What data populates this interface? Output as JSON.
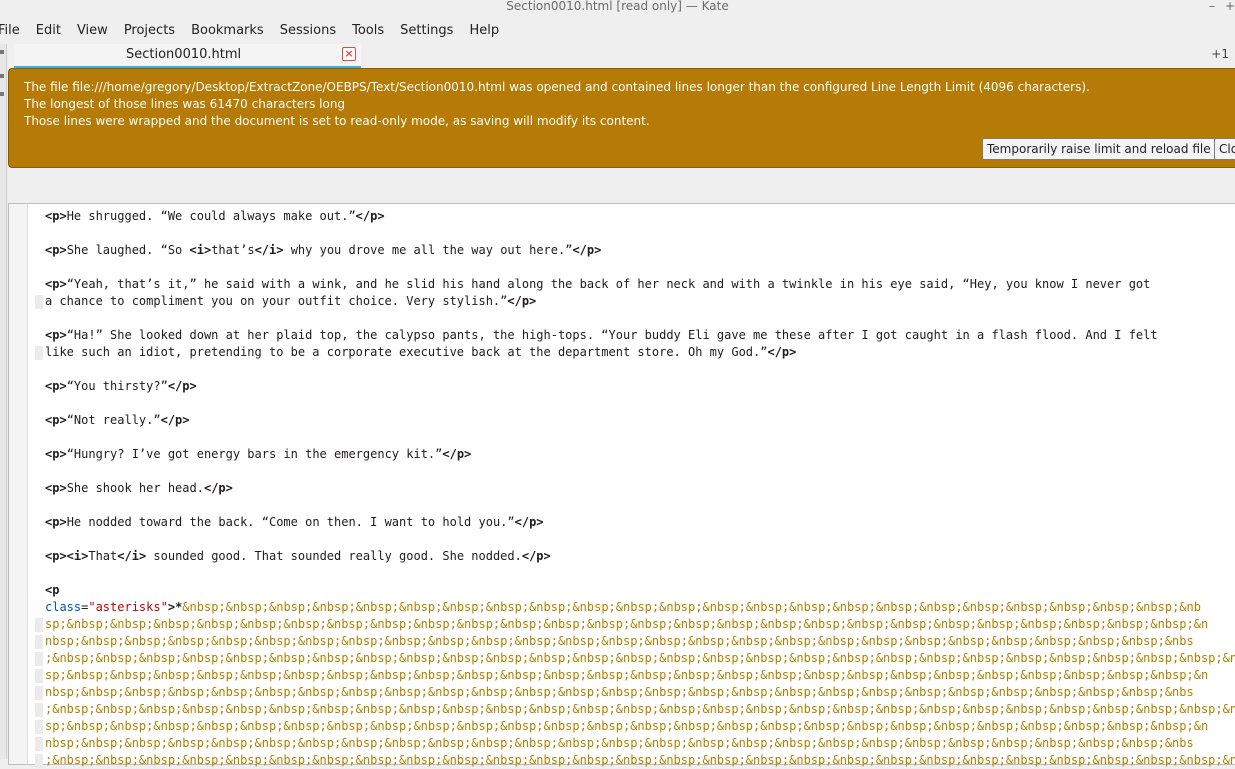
{
  "window": {
    "title": "Section0010.html [read only]  — Kate"
  },
  "menu": [
    "File",
    "Edit",
    "View",
    "Projects",
    "Bookmarks",
    "Sessions",
    "Tools",
    "Settings",
    "Help"
  ],
  "tabs": {
    "active": "Section0010.html",
    "extra": "+1"
  },
  "banner": {
    "line1": "The file file:///home/gregory/Desktop/ExtractZone/OEBPS/Text/Section0010.html was opened and contained lines longer than the configured Line Length Limit (4096 characters).",
    "line2": "The longest of those lines was 61470 characters long",
    "line3": "Those lines were wrapped and the document is set to read-only mode, as saving will modify its content.",
    "raise_button": "Temporarily raise limit and reload file",
    "close_button": "Close"
  },
  "editor": {
    "lines": [
      {
        "pre": "<p>",
        "text": "He shrugged. “We could always make out.”",
        "post": "</p>"
      },
      {
        "pre": "<p>",
        "text": "She laughed. “So ",
        "itag": "<i>",
        "itext": "that’s",
        "itagc": "</i>",
        "text2": " why you drove me all the way out here.”",
        "post": "</p>"
      },
      {
        "pre": "<p>",
        "text": "“Yeah, that’s it,” he said with a wink, and he slid his hand along the back of her neck and with a twinkle in his eye said, “Hey, you know I never got",
        "post": ""
      },
      {
        "pre": "",
        "text": "a chance to compliment you on your outfit choice. Very stylish.”",
        "post": "</p>"
      },
      {
        "pre": "<p>",
        "text": "“Ha!” She looked down at her plaid top, the calypso pants, the high-tops. “Your buddy Eli gave me these after I got caught in a flash flood. And I felt",
        "post": ""
      },
      {
        "pre": "",
        "text": "like such an idiot, pretending to be a corporate executive back at the department store. Oh my God.”",
        "post": "</p>"
      },
      {
        "pre": "<p>",
        "text": "“You thirsty?”",
        "post": "</p>"
      },
      {
        "pre": "<p>",
        "text": "“Not really.”",
        "post": "</p>"
      },
      {
        "pre": "<p>",
        "text": "“Hungry? I’ve got energy bars in the emergency kit.”",
        "post": "</p>"
      },
      {
        "pre": "<p>",
        "text": "She shook her head.",
        "post": "</p>"
      },
      {
        "pre": "<p>",
        "text": "He nodded toward the back. “Come on then. I want to hold you.”",
        "post": "</p>"
      },
      {
        "pre": "<p><i>",
        "text": "That",
        "itag": "</i>",
        "text2": " sounded good. That sounded really good. She nodded.",
        "post": "</p>"
      }
    ],
    "p_open": "<p",
    "class_attr": "class",
    "class_eq": "=",
    "class_val": "\"asterisks\"",
    "class_close": ">*",
    "entity_lines": [
      "&nbsp;&nbsp;&nbsp;&nbsp;&nbsp;&nbsp;&nbsp;&nbsp;&nbsp;&nbsp;&nbsp;&nbsp;&nbsp;&nbsp;&nbsp;&nbsp;&nbsp;&nbsp;&nbsp;&nbsp;&nbsp;&nbsp;&nbsp;&nb",
      "sp;&nbsp;&nbsp;&nbsp;&nbsp;&nbsp;&nbsp;&nbsp;&nbsp;&nbsp;&nbsp;&nbsp;&nbsp;&nbsp;&nbsp;&nbsp;&nbsp;&nbsp;&nbsp;&nbsp;&nbsp;&nbsp;&nbsp;&nbsp;&nbsp;&nbsp;&nbsp;&n",
      "nbsp;&nbsp;&nbsp;&nbsp;&nbsp;&nbsp;&nbsp;&nbsp;&nbsp;&nbsp;&nbsp;&nbsp;&nbsp;&nbsp;&nbsp;&nbsp;&nbsp;&nbsp;&nbsp;&nbsp;&nbsp;&nbsp;&nbsp;&nbsp;&nbsp;&nbsp;&nbs",
      ";&nbsp;&nbsp;&nbsp;&nbsp;&nbsp;&nbsp;&nbsp;&nbsp;&nbsp;&nbsp;&nbsp;&nbsp;&nbsp;&nbsp;&nbsp;&nbsp;&nbsp;&nbsp;&nbsp;&nbsp;&nbsp;&nbsp;&nbsp;&nbsp;&nbsp;&nbsp;&nbsp;&n",
      "sp;&nbsp;&nbsp;&nbsp;&nbsp;&nbsp;&nbsp;&nbsp;&nbsp;&nbsp;&nbsp;&nbsp;&nbsp;&nbsp;&nbsp;&nbsp;&nbsp;&nbsp;&nbsp;&nbsp;&nbsp;&nbsp;&nbsp;&nbsp;&nbsp;&nbsp;&nbsp;&n",
      "nbsp;&nbsp;&nbsp;&nbsp;&nbsp;&nbsp;&nbsp;&nbsp;&nbsp;&nbsp;&nbsp;&nbsp;&nbsp;&nbsp;&nbsp;&nbsp;&nbsp;&nbsp;&nbsp;&nbsp;&nbsp;&nbsp;&nbsp;&nbsp;&nbsp;&nbsp;&nbs",
      ";&nbsp;&nbsp;&nbsp;&nbsp;&nbsp;&nbsp;&nbsp;&nbsp;&nbsp;&nbsp;&nbsp;&nbsp;&nbsp;&nbsp;&nbsp;&nbsp;&nbsp;&nbsp;&nbsp;&nbsp;&nbsp;&nbsp;&nbsp;&nbsp;&nbsp;&nbsp;&nbsp;&n",
      "sp;&nbsp;&nbsp;&nbsp;&nbsp;&nbsp;&nbsp;&nbsp;&nbsp;&nbsp;&nbsp;&nbsp;&nbsp;&nbsp;&nbsp;&nbsp;&nbsp;&nbsp;&nbsp;&nbsp;&nbsp;&nbsp;&nbsp;&nbsp;&nbsp;&nbsp;&nbsp;&n",
      "nbsp;&nbsp;&nbsp;&nbsp;&nbsp;&nbsp;&nbsp;&nbsp;&nbsp;&nbsp;&nbsp;&nbsp;&nbsp;&nbsp;&nbsp;&nbsp;&nbsp;&nbsp;&nbsp;&nbsp;&nbsp;&nbsp;&nbsp;&nbsp;&nbsp;&nbsp;&nbs",
      ";&nbsp;&nbsp;&nbsp;&nbsp;&nbsp;&nbsp;&nbsp;&nbsp;&nbsp;&nbsp;&nbsp;&nbsp;&nbsp;&nbsp;&nbsp;&nbsp;&nbsp;&nbsp;&nbsp;&nbsp;&nbsp;&nbsp;&nbsp;&nbsp;&nbsp;&nbsp;&nbsp;&n"
    ]
  },
  "colors": {
    "banner_bg": "#b57b06",
    "tab_accent": "#3daee9",
    "entity": "#b08000",
    "attr": "#0057ae",
    "string": "#bf0303"
  }
}
